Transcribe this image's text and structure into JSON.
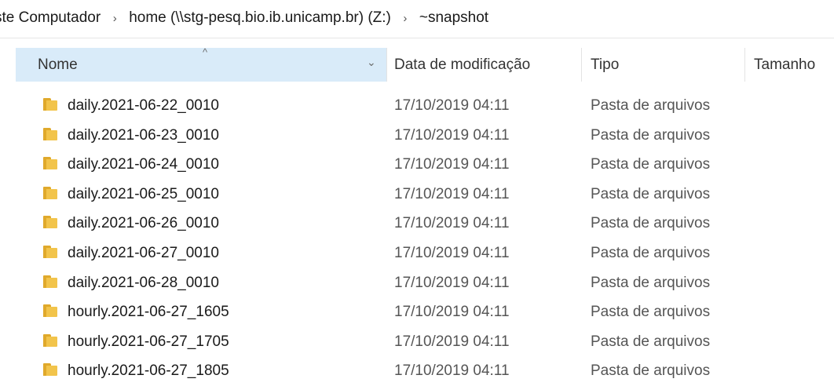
{
  "breadcrumb": [
    {
      "label": "ste Computador"
    },
    {
      "label": "home (\\\\stg-pesq.bio.ib.unicamp.br) (Z:)"
    },
    {
      "label": "~snapshot"
    }
  ],
  "breadcrumb_separator": "›",
  "columns": {
    "name": "Nome",
    "modified": "Data de modificação",
    "type": "Tipo",
    "size": "Tamanho"
  },
  "sort_indicator": "^",
  "dropdown_chevron": "⌄",
  "files": [
    {
      "name": "daily.2021-06-22_0010",
      "modified": "17/10/2019 04:11",
      "type": "Pasta de arquivos",
      "size": "",
      "icon": "folder-icon"
    },
    {
      "name": "daily.2021-06-23_0010",
      "modified": "17/10/2019 04:11",
      "type": "Pasta de arquivos",
      "size": "",
      "icon": "folder-icon"
    },
    {
      "name": "daily.2021-06-24_0010",
      "modified": "17/10/2019 04:11",
      "type": "Pasta de arquivos",
      "size": "",
      "icon": "folder-icon"
    },
    {
      "name": "daily.2021-06-25_0010",
      "modified": "17/10/2019 04:11",
      "type": "Pasta de arquivos",
      "size": "",
      "icon": "folder-icon"
    },
    {
      "name": "daily.2021-06-26_0010",
      "modified": "17/10/2019 04:11",
      "type": "Pasta de arquivos",
      "size": "",
      "icon": "folder-icon"
    },
    {
      "name": "daily.2021-06-27_0010",
      "modified": "17/10/2019 04:11",
      "type": "Pasta de arquivos",
      "size": "",
      "icon": "folder-icon"
    },
    {
      "name": "daily.2021-06-28_0010",
      "modified": "17/10/2019 04:11",
      "type": "Pasta de arquivos",
      "size": "",
      "icon": "folder-icon"
    },
    {
      "name": "hourly.2021-06-27_1605",
      "modified": "17/10/2019 04:11",
      "type": "Pasta de arquivos",
      "size": "",
      "icon": "folder-icon"
    },
    {
      "name": "hourly.2021-06-27_1705",
      "modified": "17/10/2019 04:11",
      "type": "Pasta de arquivos",
      "size": "",
      "icon": "folder-icon"
    },
    {
      "name": "hourly.2021-06-27_1805",
      "modified": "17/10/2019 04:11",
      "type": "Pasta de arquivos",
      "size": "",
      "icon": "folder-icon"
    }
  ],
  "colors": {
    "header_selected_bg": "#d9ebf9",
    "folder_yellow": "#f2c44b",
    "folder_dark": "#e0a92b",
    "secondary_text": "#555555"
  }
}
